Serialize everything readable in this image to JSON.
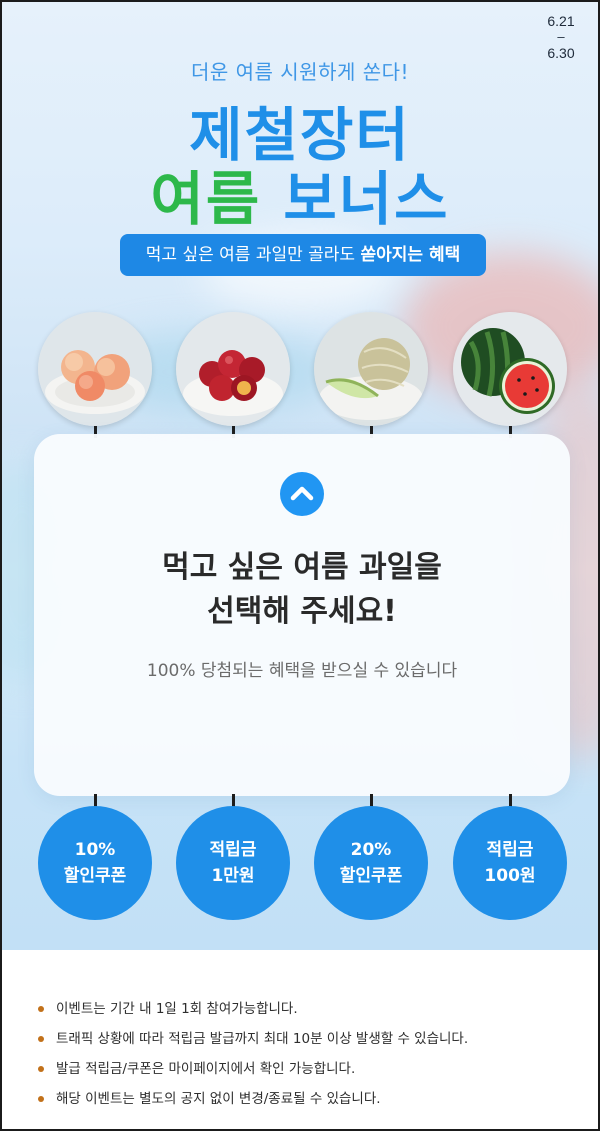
{
  "hero": {
    "date_start": "6.21",
    "date_dash": "–",
    "date_end": "6.30",
    "subtitle": "더운 여름 시원하게 쏜다!",
    "title_line1": "제철장터",
    "title_line2_part1": "여름",
    "title_line2_part2": "보너스",
    "pill_text": "먹고 싶은 여름 과일만 골라도",
    "pill_bold": "쏟아지는 혜택"
  },
  "fruits": [
    {
      "name": "peach"
    },
    {
      "name": "plum"
    },
    {
      "name": "melon"
    },
    {
      "name": "watermelon"
    }
  ],
  "card": {
    "title_line1": "먹고 싶은 여름 과일을",
    "title_line2": "선택해 주세요!",
    "description": "100% 당첨되는 혜택을 받으실 수 있습니다",
    "up_icon": "chevron-up-icon"
  },
  "rewards": [
    {
      "line1": "10%",
      "line2": "할인쿠폰"
    },
    {
      "line1": "적립금",
      "line2": "1만원"
    },
    {
      "line1": "20%",
      "line2": "할인쿠폰"
    },
    {
      "line1": "적립금",
      "line2": "100원"
    }
  ],
  "notes": [
    "이벤트는 기간 내 1일 1회 참여가능합니다.",
    "트래픽 상황에 따라 적립금 발급까지 최대 10분 이상 발생할 수 있습니다.",
    "발급 적립금/쿠폰은 마이페이지에서 확인 가능합니다.",
    "해당 이벤트는 별도의 공지 없이 변경/종료될 수 있습니다."
  ],
  "colors": {
    "primary_blue": "#1f8fe8",
    "accent_green": "#2db84a",
    "bullet": "#c2711a"
  }
}
